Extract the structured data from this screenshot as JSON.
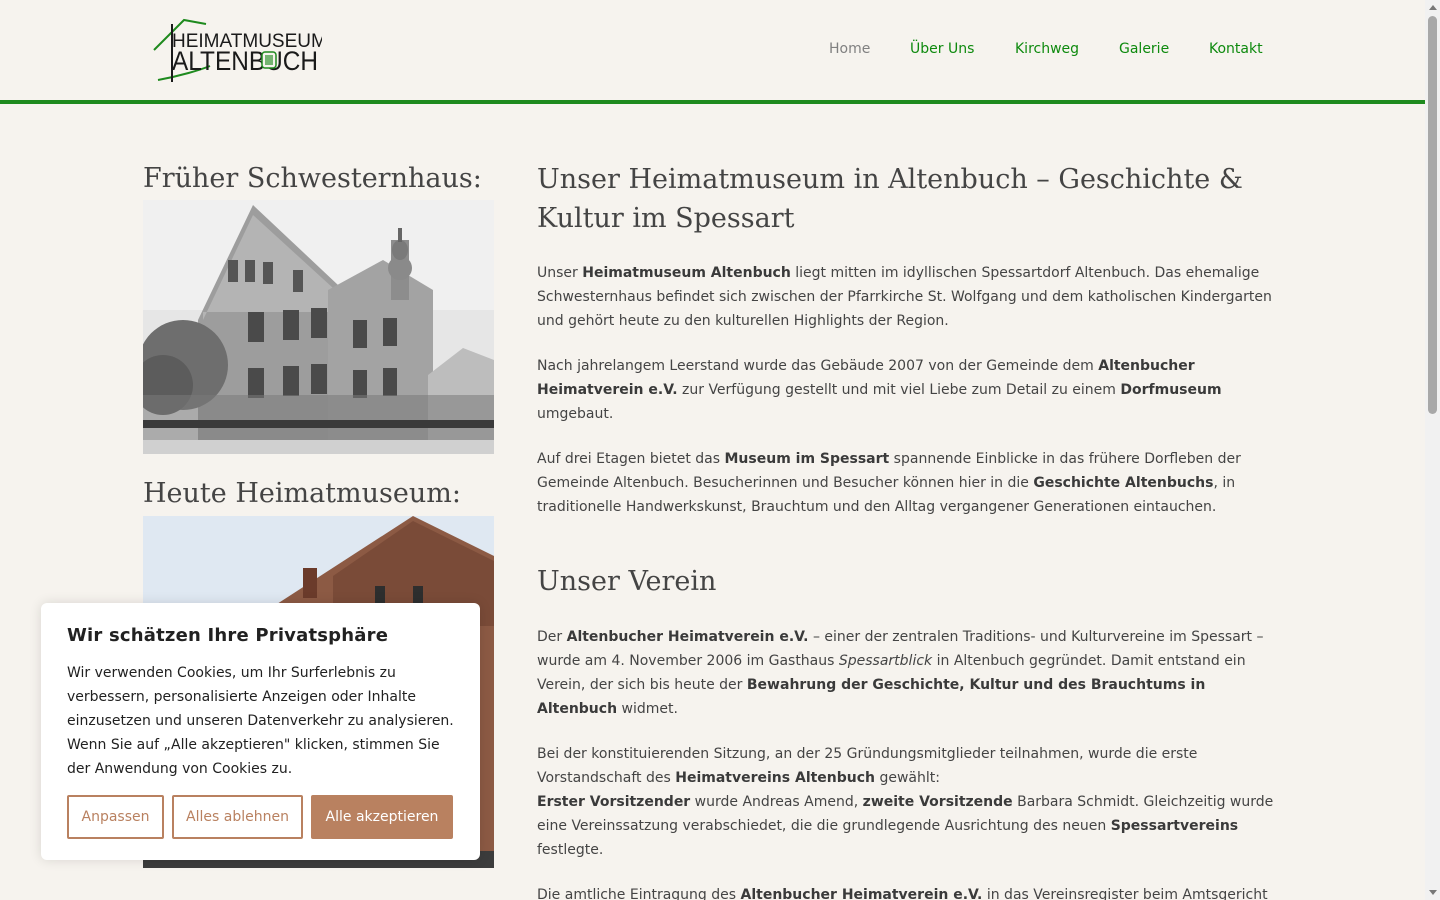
{
  "header": {
    "logo": {
      "line1": "HEIMATMUSEUM",
      "line2": "ALTENBUCH",
      "colors": {
        "green": "#1e8a1e",
        "text": "#1a1a1a"
      }
    },
    "nav": [
      {
        "label": "Home",
        "active": true
      },
      {
        "label": "Über Uns",
        "active": false
      },
      {
        "label": "Kirchweg",
        "active": false
      },
      {
        "label": "Galerie",
        "active": false
      },
      {
        "label": "Kontakt",
        "active": false
      }
    ]
  },
  "sidebar": {
    "heading1": "Früher Schwesternhaus:",
    "heading2": "Heute Heimatmuseum:"
  },
  "main": {
    "title": "Unser Heimatmuseum in Altenbuch – Geschichte & Kultur im Spessart",
    "p1": {
      "t1": "Unser ",
      "b1": "Heimatmuseum Altenbuch",
      "t2": " liegt mitten im idyllischen Spessartdorf Altenbuch. Das ehemalige Schwesternhaus befindet sich zwischen der Pfarrkirche St. Wolfgang und dem katholischen Kindergarten und gehört heute zu den kulturellen Highlights der Region."
    },
    "p2": {
      "t1": "Nach jahrelangem Leerstand wurde das Gebäude 2007 von der Gemeinde dem ",
      "b1": "Altenbucher Heimatverein e.V.",
      "t2": " zur Verfügung gestellt und mit viel Liebe zum Detail zu einem ",
      "b2": "Dorfmuseum",
      "t3": " umgebaut."
    },
    "p3": {
      "t1": "Auf drei Etagen bietet das ",
      "b1": "Museum im Spessart",
      "t2": " spannende Einblicke in das frühere Dorfleben der Gemeinde Altenbuch. Besucherinnen und Besucher können hier in die ",
      "b2": "Geschichte Altenbuchs",
      "t3": ", in traditionelle Handwerkskunst, Brauchtum und den Alltag vergangener Generationen eintauchen."
    },
    "subtitle": "Unser Verein",
    "p4": {
      "t1": "Der ",
      "b1": "Altenbucher Heimatverein e.V.",
      "t2": " – einer der zentralen Traditions- und Kulturvereine im Spessart – wurde am 4. November 2006 im Gasthaus ",
      "i1": "Spessartblick",
      "t3": " in Altenbuch gegründet. Damit entstand ein Verein, der sich bis heute der ",
      "b2": "Bewahrung der Geschichte, Kultur und des Brauchtums in Altenbuch",
      "t4": " widmet."
    },
    "p5": {
      "t1": "Bei der konstituierenden Sitzung, an der 25 Gründungsmitglieder teilnahmen, wurde die erste Vorstandschaft des ",
      "b1": "Heimatvereins Altenbuch",
      "t2": " gewählt:",
      "b2": "Erster Vorsitzender",
      "t3": " wurde Andreas Amend, ",
      "b3": "zweite Vorsitzende",
      "t4": " Barbara Schmidt. Gleichzeitig wurde eine Vereinssatzung verabschiedet, die die grundlegende Ausrichtung des neuen ",
      "b4": "Spessartvereins",
      "t5": " festlegte."
    },
    "p6": {
      "t1": "Die amtliche Eintragung des ",
      "b1": "Altenbucher Heimatverein e.V.",
      "t2": " in das Vereinsregister beim Amtsgericht"
    }
  },
  "cookie": {
    "title": "Wir schätzen Ihre Privatsphäre",
    "text": "Wir verwenden Cookies, um Ihr Surferlebnis zu verbessern, personalisierte Anzeigen oder Inhalte einzusetzen und unseren Datenverkehr zu analysieren. Wenn Sie auf „Alle akzeptieren\" klicken, stimmen Sie der Anwendung von Cookies zu.",
    "customize_label": "Anpassen",
    "reject_label": "Alles ablehnen",
    "accept_label": "Alle akzeptieren",
    "accent_color": "#b98160"
  }
}
